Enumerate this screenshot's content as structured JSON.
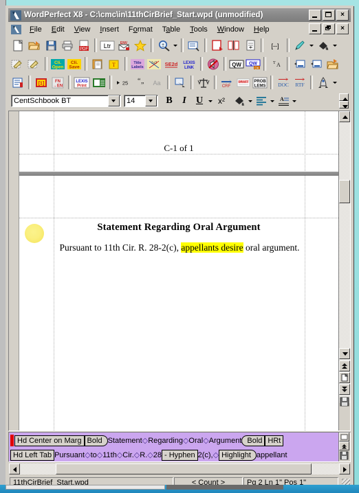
{
  "window": {
    "title": "WordPerfect X8 - C:\\cmc\\in\\11thCirBrief_Start.wpd (unmodified)",
    "app_icon": "wordperfect-icon",
    "buttons": {
      "minimize": "_",
      "maximize": "□",
      "close": "×"
    }
  },
  "document_window": {
    "buttons": {
      "minimize": "_",
      "restore": "❐",
      "close": "×"
    }
  },
  "menu": {
    "icon": "document-menu-icon",
    "items": [
      {
        "label": "File",
        "accel": "F"
      },
      {
        "label": "Edit",
        "accel": "E"
      },
      {
        "label": "View",
        "accel": "V"
      },
      {
        "label": "Insert",
        "accel": "I"
      },
      {
        "label": "Format",
        "accel": "o"
      },
      {
        "label": "Table",
        "accel": "a"
      },
      {
        "label": "Tools",
        "accel": "T"
      },
      {
        "label": "Window",
        "accel": "W"
      },
      {
        "label": "Help",
        "accel": "H"
      }
    ]
  },
  "toolbar_row1": [
    {
      "name": "new-document-button",
      "glyph": "⬜",
      "kind": "page",
      "color": "#ffffff"
    },
    {
      "name": "open-document-button",
      "glyph": "",
      "kind": "openfolder",
      "color": "#f5a623"
    },
    {
      "name": "save-document-button",
      "glyph": "",
      "kind": "floppy",
      "color": "#2a5caa"
    },
    {
      "name": "print-button",
      "glyph": "",
      "kind": "printer",
      "color": "#bcbcbc"
    },
    {
      "name": "publish-to-pdf-button",
      "glyph": "PDF",
      "kind": "pdf",
      "color": "#cc2222"
    },
    {
      "sep": true
    },
    {
      "name": "letter-format-button",
      "glyph": "Ltr",
      "kind": "text",
      "color": "#000000"
    },
    {
      "name": "envelope-button",
      "glyph": "ENV",
      "kind": "envelope",
      "color": "#cc2222"
    },
    {
      "name": "favorites-button",
      "glyph": "★",
      "kind": "star",
      "color": "#ffcc00"
    },
    {
      "sep": true
    },
    {
      "name": "zoom-button",
      "glyph": "",
      "kind": "zoom",
      "color": "#2a5caa"
    },
    {
      "name": "zoom-dropdown-arrow",
      "kind": "arrow"
    },
    {
      "sep": true
    },
    {
      "name": "reveal-codes-button",
      "glyph": "",
      "kind": "reveal",
      "color": "#2a5caa"
    },
    {
      "sep": true
    },
    {
      "name": "page-border-button",
      "glyph": "",
      "kind": "border",
      "color": "#cc2222"
    },
    {
      "name": "columns-button",
      "glyph": "",
      "kind": "columns",
      "color": "#cc2222"
    },
    {
      "name": "insert-page-button",
      "glyph": "",
      "kind": "insertpg",
      "color": "#555555"
    },
    {
      "sep": true
    },
    {
      "name": "insert-brackets-button",
      "glyph": "[...]",
      "kind": "text",
      "color": "#000000"
    },
    {
      "sep": true
    },
    {
      "name": "highlight-button",
      "glyph": "",
      "kind": "pen",
      "color": "#2fa8a8"
    },
    {
      "name": "highlight-dropdown-arrow",
      "kind": "arrow"
    },
    {
      "name": "font-color-button",
      "glyph": "",
      "kind": "bucket",
      "color": "#1a1a1a"
    },
    {
      "name": "font-color-dropdown-arrow",
      "kind": "arrow"
    }
  ],
  "toolbar_row2": [
    {
      "name": "edit-client-button",
      "kind": "pen2",
      "color": "#cccccc"
    },
    {
      "name": "edit-client2-button",
      "kind": "pen2",
      "color": "#cccccc"
    },
    {
      "sep": true
    },
    {
      "name": "client-open-button",
      "glyph": "Cli.\nOpen",
      "kind": "label",
      "color": "#00a0a0"
    },
    {
      "name": "client-save-button",
      "glyph": "Cli.\nSave",
      "kind": "label",
      "color": "#e8c000"
    },
    {
      "sep": true
    },
    {
      "name": "paste-button",
      "kind": "clipboard",
      "color": "#e8a33d"
    },
    {
      "name": "typeset-button",
      "kind": "typeset",
      "color": "#e8c000"
    },
    {
      "sep": true
    },
    {
      "name": "title-labels-button",
      "glyph": "Title\nLabels",
      "kind": "label",
      "color": "#d0a0d0"
    },
    {
      "name": "size-1x2-button",
      "glyph": "1x2",
      "kind": "label",
      "color": "#e8e0a0"
    },
    {
      "name": "se2d-button",
      "glyph": "SE2d",
      "kind": "text",
      "color": "#cc2222"
    },
    {
      "name": "lexis-link-button",
      "glyph": "LEXIS\nLINK",
      "kind": "text",
      "color": "#2020cc"
    },
    {
      "sep": true
    },
    {
      "name": "no-sound-button",
      "kind": "nosound",
      "color": "#cc2222"
    },
    {
      "sep": true
    },
    {
      "name": "qw-button",
      "glyph": "QW",
      "kind": "label",
      "color": "#1a1a1a"
    },
    {
      "name": "qw-ok-button",
      "glyph": "QW",
      "kind": "label",
      "color": "#2020cc"
    },
    {
      "sep": true
    },
    {
      "name": "sort-az-button",
      "glyph": "ᵀA",
      "kind": "text",
      "color": "#1a1a1a"
    },
    {
      "sep": true
    },
    {
      "name": "insert-field-button",
      "kind": "field",
      "color": "#2a5caa"
    },
    {
      "name": "insert-field2-button",
      "kind": "field",
      "color": "#2a5caa"
    },
    {
      "name": "open-recent-button",
      "kind": "openfolder",
      "color": "#f5a623"
    }
  ],
  "toolbar_row3": [
    {
      "name": "book-button",
      "kind": "book",
      "color": "#2a5caa"
    },
    {
      "sep": true
    },
    {
      "name": "numbering-button",
      "glyph": "[1]",
      "kind": "label",
      "color": "#e8c000"
    },
    {
      "name": "footnote-endnote-button",
      "glyph": "FN\n→EN",
      "kind": "label",
      "color": "#cc2222"
    },
    {
      "sep": true
    },
    {
      "name": "lexis-print-button",
      "glyph": "LEXIS\nPrint",
      "kind": "label",
      "color": "#cc2222"
    },
    {
      "name": "green-doc-button",
      "kind": "greendoc",
      "color": "#2a7a2a"
    },
    {
      "sep": true
    },
    {
      "name": "indent-25-button",
      "glyph": "▸25",
      "kind": "text",
      "color": "#1a1a1a"
    },
    {
      "name": "quotes-button",
      "glyph": "“”",
      "kind": "text",
      "color": "#1a1a1a"
    },
    {
      "name": "change-case-button",
      "glyph": "Aa",
      "kind": "text",
      "color": "#8a8a8a"
    },
    {
      "sep": true
    },
    {
      "name": "select-object-button",
      "kind": "select",
      "color": "#2a5caa"
    },
    {
      "sep": true
    },
    {
      "name": "scales-justice-button",
      "kind": "scales",
      "color": "#1a1a1a"
    },
    {
      "sep": true
    },
    {
      "name": "cref-button",
      "glyph": "CRF",
      "kind": "label",
      "color": "#2a5caa"
    },
    {
      "name": "draft-button",
      "glyph": "DRAFT",
      "kind": "label",
      "color": "#cc2222"
    },
    {
      "name": "problems-button",
      "glyph": "PROB\nLEMS",
      "kind": "label",
      "color": "#1a1a1a"
    },
    {
      "sep": true
    },
    {
      "name": "convert-doc-button",
      "glyph": "DOC",
      "kind": "text",
      "color": "#cc2222"
    },
    {
      "name": "convert-rtf-button",
      "glyph": "RTF",
      "kind": "text",
      "color": "#cc2222"
    },
    {
      "sep": true
    },
    {
      "name": "macro-button",
      "kind": "macro",
      "color": "#1a1a1a"
    },
    {
      "name": "macro-dropdown-arrow",
      "kind": "arrow"
    }
  ],
  "property_bar": {
    "font_name": "CentSchbook BT",
    "font_size": "14",
    "bold_label": "B",
    "italic_label": "I",
    "underline_label": "U",
    "superscript_label": "x²",
    "highlight_name": "highlight-bucket-icon",
    "justification_name": "justification-icon",
    "styles_name": "text-style-icon"
  },
  "document": {
    "footer_text": "C-1 of 1",
    "heading": "Statement Regarding Oral Argument",
    "body_pre": "Pursuant to 11th Cir. R. 28-2(c), ",
    "body_highlight": "appellants desire",
    "body_post": " oral argument."
  },
  "reveal_codes": {
    "line1": [
      {
        "type": "cursor"
      },
      {
        "type": "code",
        "text": "Hd Center on Marg",
        "shape": "box"
      },
      {
        "type": "code",
        "text": "Bold",
        "shape": "left"
      },
      {
        "type": "text",
        "text": "Statement"
      },
      {
        "type": "space"
      },
      {
        "type": "text",
        "text": "Regarding"
      },
      {
        "type": "space"
      },
      {
        "type": "text",
        "text": "Oral"
      },
      {
        "type": "space"
      },
      {
        "type": "text",
        "text": "Argument"
      },
      {
        "type": "code",
        "text": "Bold",
        "shape": "right"
      },
      {
        "type": "code",
        "text": "HRt",
        "shape": "box"
      }
    ],
    "line2": [
      {
        "type": "code",
        "text": "Hd Left Tab",
        "shape": "box"
      },
      {
        "type": "text",
        "text": "Pursuant"
      },
      {
        "type": "space"
      },
      {
        "type": "text",
        "text": "to"
      },
      {
        "type": "space"
      },
      {
        "type": "text",
        "text": "11th"
      },
      {
        "type": "space"
      },
      {
        "type": "text",
        "text": "Cir."
      },
      {
        "type": "space"
      },
      {
        "type": "text",
        "text": "R."
      },
      {
        "type": "space"
      },
      {
        "type": "text",
        "text": "28"
      },
      {
        "type": "code",
        "text": "- Hyphen",
        "shape": "box"
      },
      {
        "type": "text",
        "text": "2(c),"
      },
      {
        "type": "space"
      },
      {
        "type": "code",
        "text": "Highlight",
        "shape": "left"
      },
      {
        "type": "text",
        "text": "appellant"
      }
    ]
  },
  "vertical_scrollbar": {
    "up_arrow": "scroll-up-arrow",
    "down_arrow": "scroll-down-arrow",
    "prev_page": "previous-page-button",
    "page_browse": "browse-by-page-button",
    "next_page": "next-page-button",
    "quicksave": "quicksave-icon"
  },
  "status_bar": {
    "filename": "11thCirBrief_Start.wpd",
    "count": "< Count >",
    "position": "Pg 2 Ln 1\" Pos 1\""
  },
  "colors": {
    "reveal_pane_bg": "#cba6ef",
    "highlight_yellow": "#ffff00",
    "titlebar": "#8a8a8a",
    "chrome": "#d4d0c8",
    "desktop": "#9fe2e2"
  }
}
